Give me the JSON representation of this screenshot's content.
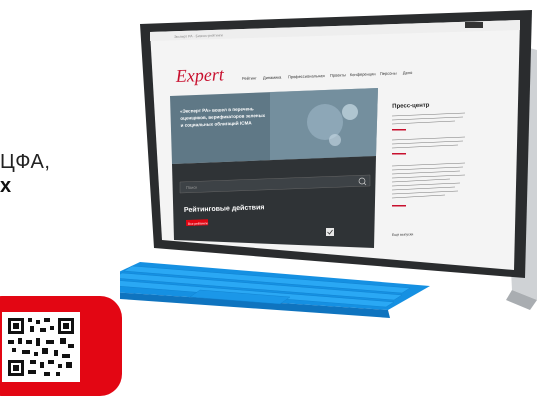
{
  "left": {
    "line1": "ЦФА,",
    "line2": "х"
  },
  "screen": {
    "logo": "Expert",
    "nav": [
      "Рейтинг",
      "Динамика",
      "Профессиональная",
      "Проекты",
      "Конференции",
      "Персоны",
      "Дело"
    ],
    "hero_title_lines": [
      "«Эксперт РА» вошел в перечень",
      "оценщиков, верификаторов зеленых",
      "и социальных облигаций ICMA"
    ],
    "search_placeholder": "Поиск",
    "ratings_title": "Рейтинговые действия",
    "ratings_tag": "Все рейтинги",
    "press_title": "Пресс-центр",
    "press_more": "Ещё выпуски"
  },
  "colors": {
    "accent": "#e30613",
    "keyboard": "#1ea0f0",
    "screen_dark": "#2f3336"
  }
}
